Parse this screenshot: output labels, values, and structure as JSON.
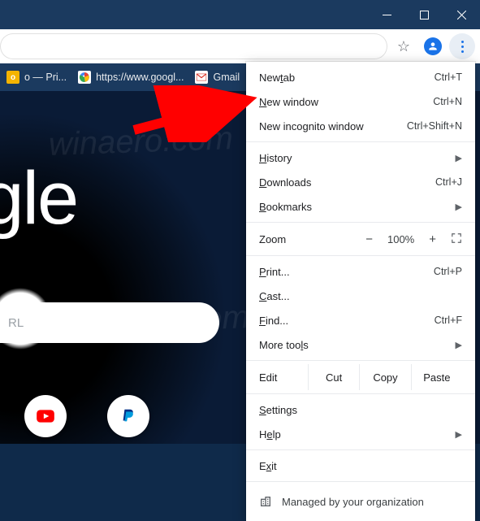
{
  "window_controls": {
    "minimize": "minimize",
    "maximize": "maximize",
    "close": "close"
  },
  "omnibox": {
    "star": "☆",
    "profile": "profile"
  },
  "bookmarks": {
    "items": [
      {
        "label": "o — Pri..."
      },
      {
        "label": "https://www.googl..."
      },
      {
        "label": "Gmail"
      }
    ]
  },
  "page": {
    "logo_text": "oogle",
    "search_hint": "RL"
  },
  "menu": {
    "new_tab": {
      "label_pre": "New ",
      "ul": "t",
      "label_post": "ab",
      "shortcut": "Ctrl+T"
    },
    "new_window": {
      "ul": "N",
      "label_post": "ew window",
      "shortcut": "Ctrl+N"
    },
    "incognito": {
      "label": "New incognito window",
      "shortcut": "Ctrl+Shift+N"
    },
    "history": {
      "ul": "H",
      "label_post": "istory"
    },
    "downloads": {
      "ul": "D",
      "label_post": "ownloads",
      "shortcut": "Ctrl+J"
    },
    "bookmarks": {
      "ul": "B",
      "label_post": "ookmarks"
    },
    "zoom": {
      "label": "Zoom",
      "minus": "−",
      "value": "100%",
      "plus": "+"
    },
    "print": {
      "ul": "P",
      "label_post": "rint...",
      "shortcut": "Ctrl+P"
    },
    "cast": {
      "ul": "C",
      "label_post": "ast..."
    },
    "find": {
      "ul": "F",
      "label_post": "ind...",
      "shortcut": "Ctrl+F"
    },
    "more_tools": {
      "label_pre": "More too",
      "ul": "l",
      "label_post": "s"
    },
    "edit": {
      "label": "Edit",
      "cut": "Cut",
      "copy": "Copy",
      "paste": "Paste"
    },
    "settings": {
      "ul": "S",
      "label_post": "ettings"
    },
    "help": {
      "label_pre": "H",
      "ul": "e",
      "label_post": "lp"
    },
    "exit": {
      "label_pre": "E",
      "ul": "x",
      "label_post": "it"
    },
    "managed": "Managed by your organization"
  }
}
